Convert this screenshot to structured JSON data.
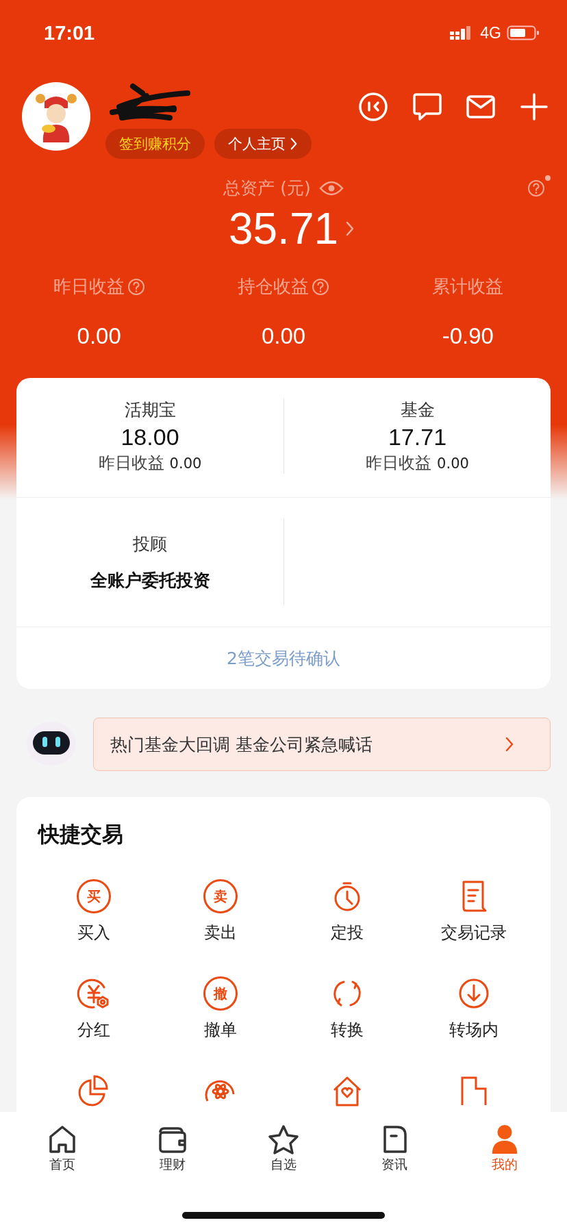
{
  "status_bar": {
    "time": "17:01",
    "network": "4G"
  },
  "profile": {
    "chips": [
      {
        "label": "签到赚积分",
        "kind": "reward"
      },
      {
        "label": "个人主页",
        "kind": "link"
      }
    ]
  },
  "assets": {
    "label": "总资产 (元)",
    "value": "35.71"
  },
  "metrics": [
    {
      "label": "昨日收益",
      "help": true,
      "value": "0.00"
    },
    {
      "label": "持仓收益",
      "help": true,
      "value": "0.00"
    },
    {
      "label": "累计收益",
      "help": false,
      "value": "-0.90"
    }
  ],
  "holdings": {
    "cells": [
      {
        "name": "活期宝",
        "value": "18.00",
        "sub_label": "昨日收益",
        "sub_value": "0.00"
      },
      {
        "name": "基金",
        "value": "17.71",
        "sub_label": "昨日收益",
        "sub_value": "0.00"
      }
    ],
    "advisor": {
      "name": "投顾",
      "title": "全账户委托投资"
    },
    "pending": "2笔交易待确认"
  },
  "banner": {
    "text": "热门基金大回调 基金公司紧急喊话"
  },
  "quick_trade": {
    "title": "快捷交易",
    "items": [
      {
        "label": "买入",
        "badge": "买"
      },
      {
        "label": "卖出",
        "badge": "卖"
      },
      {
        "label": "定投"
      },
      {
        "label": "交易记录"
      },
      {
        "label": "分红"
      },
      {
        "label": "撤单",
        "badge": "撤"
      },
      {
        "label": "转换"
      },
      {
        "label": "转场内"
      }
    ]
  },
  "tabs": [
    {
      "label": "首页",
      "selected": false
    },
    {
      "label": "理财",
      "selected": false
    },
    {
      "label": "自选",
      "selected": false
    },
    {
      "label": "资讯",
      "selected": false
    },
    {
      "label": "我的",
      "selected": true
    }
  ]
}
